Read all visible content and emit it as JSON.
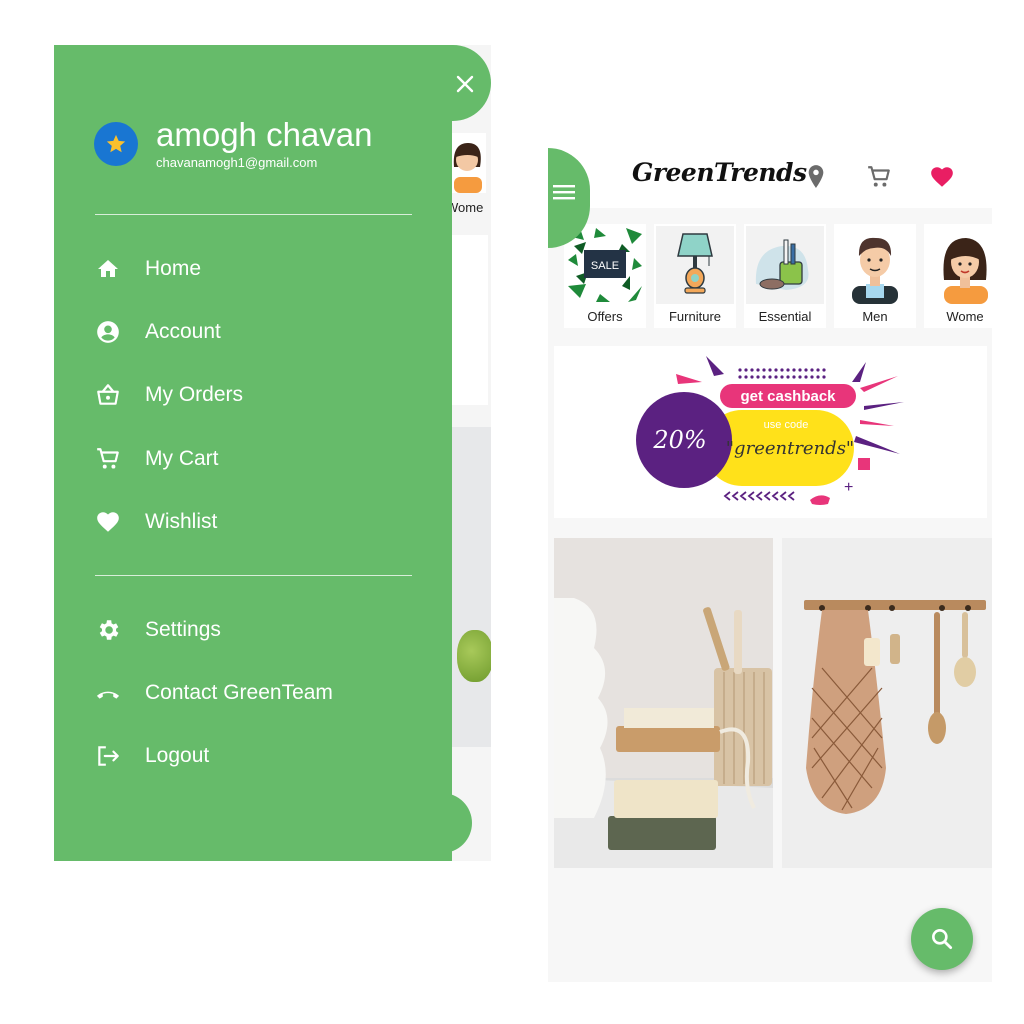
{
  "drawer": {
    "user_name": "amogh chavan",
    "user_email": "chavanamogh1@gmail.com",
    "menu_primary": [
      {
        "label": "Home",
        "icon": "home-icon"
      },
      {
        "label": "Account",
        "icon": "account-icon"
      },
      {
        "label": "My Orders",
        "icon": "basket-icon"
      },
      {
        "label": "My Cart",
        "icon": "cart-icon"
      },
      {
        "label": "Wishlist",
        "icon": "heart-icon"
      }
    ],
    "menu_secondary": [
      {
        "label": "Settings",
        "icon": "gear-icon"
      },
      {
        "label": "Contact GreenTeam",
        "icon": "phone-hangup-icon"
      },
      {
        "label": "Logout",
        "icon": "logout-icon"
      }
    ],
    "background_partial_label": "Wome"
  },
  "home": {
    "logo": "GreenTrends",
    "categories": [
      {
        "label": "Offers"
      },
      {
        "label": "Furniture"
      },
      {
        "label": "Essential"
      },
      {
        "label": "Men"
      },
      {
        "label": "Wome"
      }
    ],
    "banner": {
      "percent": "20%",
      "headline": "get cashback",
      "use_code": "use code",
      "code": "\"greentrends\"",
      "sale_sign": "SALE"
    }
  },
  "colors": {
    "primary_green": "#66bb6a",
    "avatar_blue": "#1976d2",
    "star": "#fbc02d",
    "heart_pink": "#e91e63",
    "banner_purple": "#5b2181",
    "banner_yellow": "#ffe11a",
    "banner_pink": "#e8357a"
  }
}
